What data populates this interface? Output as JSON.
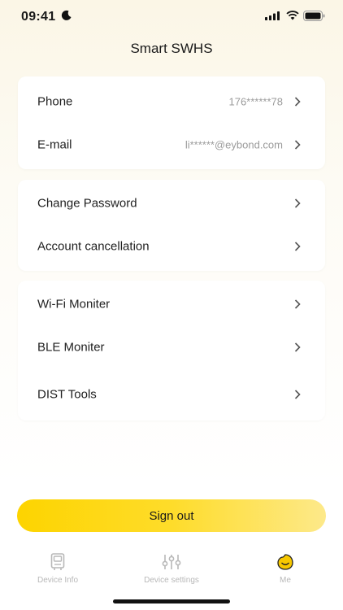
{
  "status_bar": {
    "time": "09:41"
  },
  "header": {
    "title": "Smart SWHS"
  },
  "account_card": {
    "rows": [
      {
        "label": "Phone",
        "value": "176******78"
      },
      {
        "label": "E-mail",
        "value": "li******@eybond.com"
      }
    ]
  },
  "security_card": {
    "rows": [
      {
        "label": "Change Password"
      },
      {
        "label": "Account cancellation"
      }
    ]
  },
  "tools_card": {
    "rows": [
      {
        "label": "Wi-Fi Moniter"
      },
      {
        "label": "BLE Moniter"
      },
      {
        "label": "DIST Tools"
      }
    ]
  },
  "sign_out_label": "Sign out",
  "tab_bar": {
    "tabs": [
      {
        "label": "Device Info",
        "icon": "device-info-icon"
      },
      {
        "label": "Device settings",
        "icon": "sliders-icon"
      },
      {
        "label": "Me",
        "icon": "me-face-icon",
        "active": true
      }
    ]
  },
  "colors": {
    "accent": "#fdd400",
    "active_tab_icon": "#f7c800",
    "inactive_tab": "#b8b8b8"
  }
}
